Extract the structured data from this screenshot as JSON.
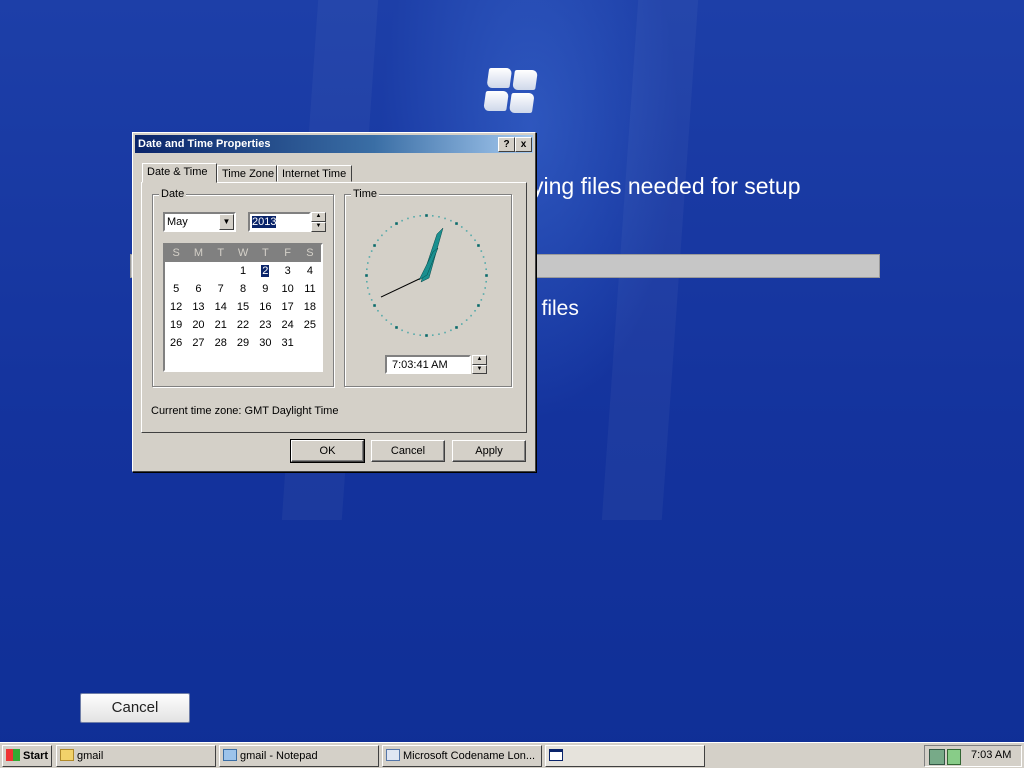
{
  "desktop": {
    "setup_heading": "ying files needed for setup",
    "setup_status": "p files",
    "cancel_label": "Cancel"
  },
  "dialog": {
    "title": "Date and Time Properties",
    "help_button": "?",
    "close_button": "x",
    "tabs": [
      {
        "label": "Date & Time",
        "active": true
      },
      {
        "label": "Time Zone",
        "active": false
      },
      {
        "label": "Internet Time",
        "active": false
      }
    ],
    "date_group_label": "Date",
    "time_group_label": "Time",
    "month_value": "May",
    "year_value": "2013",
    "weekday_headers": [
      "S",
      "M",
      "T",
      "W",
      "T",
      "F",
      "S"
    ],
    "calendar_days": [
      "",
      "",
      "",
      "1",
      "2",
      "3",
      "4",
      "5",
      "6",
      "7",
      "8",
      "9",
      "10",
      "11",
      "12",
      "13",
      "14",
      "15",
      "16",
      "17",
      "18",
      "19",
      "20",
      "21",
      "22",
      "23",
      "24",
      "25",
      "26",
      "27",
      "28",
      "29",
      "30",
      "31",
      ""
    ],
    "selected_day": "2",
    "time_value": "7:03:41 AM",
    "timezone_text": "Current time zone:  GMT Daylight Time",
    "ok_label": "OK",
    "cancel_label": "Cancel",
    "apply_label": "Apply"
  },
  "taskbar": {
    "start_label": "Start",
    "items": [
      {
        "label": "gmail",
        "icon": "folder-icon"
      },
      {
        "label": "gmail - Notepad",
        "icon": "notepad-icon"
      },
      {
        "label": "Microsoft Codename Lon...",
        "icon": "setup-icon"
      },
      {
        "label": "",
        "icon": "window-icon"
      }
    ],
    "clock": "7:03 AM"
  },
  "colors": {
    "desktop_blue": "#14339d",
    "titlebar_start": "#0a246a",
    "titlebar_end": "#a6caf0",
    "dialog_gray": "#d4d0c8",
    "clock_hand": "#1a8f8f"
  }
}
